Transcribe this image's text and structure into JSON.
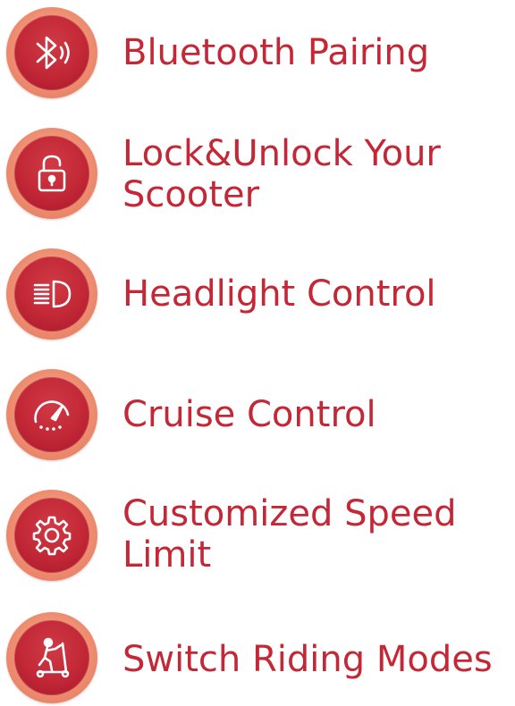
{
  "features": [
    {
      "icon": "bluetooth-icon",
      "lines": [
        "Bluetooth Pairing"
      ]
    },
    {
      "icon": "padlock-icon",
      "lines": [
        "Lock&Unlock Your",
        "Scooter"
      ]
    },
    {
      "icon": "headlight-icon",
      "lines": [
        "Headlight Control"
      ]
    },
    {
      "icon": "speedometer-icon",
      "lines": [
        "Cruise Control"
      ]
    },
    {
      "icon": "gear-icon",
      "lines": [
        "Customized Speed",
        "Limit"
      ]
    },
    {
      "icon": "scooter-rider-icon",
      "lines": [
        "Switch Riding Modes"
      ]
    }
  ],
  "colors": {
    "text": "#c42736",
    "badge_inner": "#c22736",
    "badge_ring": "#ee8f72"
  }
}
